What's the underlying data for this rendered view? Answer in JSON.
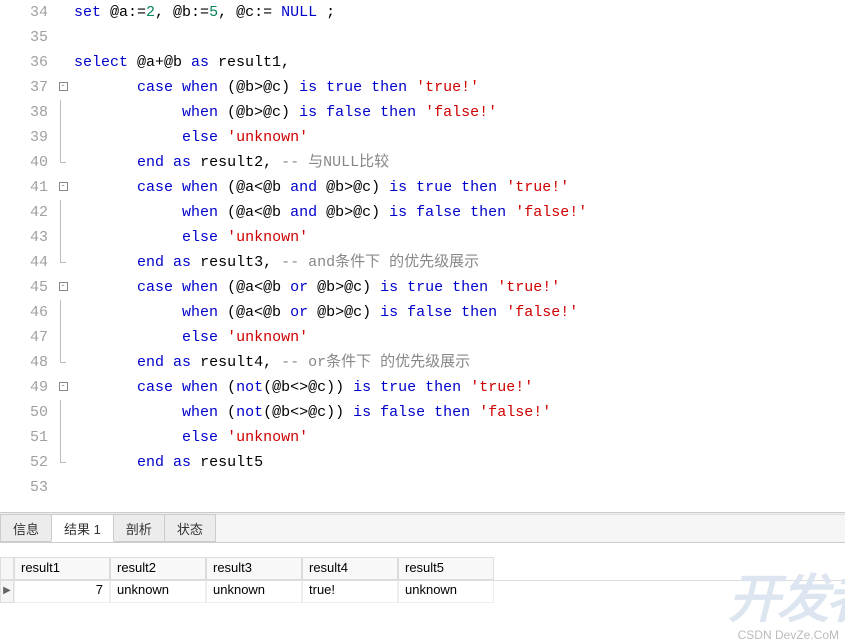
{
  "lines": [
    {
      "n": 34,
      "fold": "",
      "segs": [
        {
          "t": "set",
          "c": "kw"
        },
        {
          "t": " @a:="
        },
        {
          "t": "2",
          "c": "num"
        },
        {
          "t": ", @b:="
        },
        {
          "t": "5",
          "c": "num"
        },
        {
          "t": ", @c:= "
        },
        {
          "t": "NULL",
          "c": "kw"
        },
        {
          "t": " ;"
        }
      ]
    },
    {
      "n": 35,
      "fold": "",
      "segs": [
        {
          "t": ""
        }
      ]
    },
    {
      "n": 36,
      "fold": "",
      "segs": [
        {
          "t": "select",
          "c": "kw"
        },
        {
          "t": " @a+@b "
        },
        {
          "t": "as",
          "c": "kw"
        },
        {
          "t": " result1,"
        }
      ]
    },
    {
      "n": 37,
      "fold": "box",
      "segs": [
        {
          "t": "       "
        },
        {
          "t": "case",
          "c": "kw"
        },
        {
          "t": " "
        },
        {
          "t": "when",
          "c": "kw"
        },
        {
          "t": " (@b>@c) "
        },
        {
          "t": "is",
          "c": "kw"
        },
        {
          "t": " "
        },
        {
          "t": "true",
          "c": "kw"
        },
        {
          "t": " "
        },
        {
          "t": "then",
          "c": "kw"
        },
        {
          "t": " "
        },
        {
          "t": "'true!'",
          "c": "str"
        }
      ]
    },
    {
      "n": 38,
      "fold": "line",
      "segs": [
        {
          "t": "            "
        },
        {
          "t": "when",
          "c": "kw"
        },
        {
          "t": " (@b>@c) "
        },
        {
          "t": "is",
          "c": "kw"
        },
        {
          "t": " "
        },
        {
          "t": "false",
          "c": "kw"
        },
        {
          "t": " "
        },
        {
          "t": "then",
          "c": "kw"
        },
        {
          "t": " "
        },
        {
          "t": "'false!'",
          "c": "str"
        }
      ]
    },
    {
      "n": 39,
      "fold": "line",
      "segs": [
        {
          "t": "            "
        },
        {
          "t": "else",
          "c": "kw"
        },
        {
          "t": " "
        },
        {
          "t": "'unknown'",
          "c": "str"
        }
      ]
    },
    {
      "n": 40,
      "fold": "end",
      "segs": [
        {
          "t": "       "
        },
        {
          "t": "end",
          "c": "kw"
        },
        {
          "t": " "
        },
        {
          "t": "as",
          "c": "kw"
        },
        {
          "t": " result2, "
        },
        {
          "t": "-- 与NULL比较",
          "c": "cmt"
        }
      ]
    },
    {
      "n": 41,
      "fold": "box",
      "segs": [
        {
          "t": "       "
        },
        {
          "t": "case",
          "c": "kw"
        },
        {
          "t": " "
        },
        {
          "t": "when",
          "c": "kw"
        },
        {
          "t": " (@a<@b "
        },
        {
          "t": "and",
          "c": "kw"
        },
        {
          "t": " @b>@c) "
        },
        {
          "t": "is",
          "c": "kw"
        },
        {
          "t": " "
        },
        {
          "t": "true",
          "c": "kw"
        },
        {
          "t": " "
        },
        {
          "t": "then",
          "c": "kw"
        },
        {
          "t": " "
        },
        {
          "t": "'true!'",
          "c": "str"
        }
      ]
    },
    {
      "n": 42,
      "fold": "line",
      "segs": [
        {
          "t": "            "
        },
        {
          "t": "when",
          "c": "kw"
        },
        {
          "t": " (@a<@b "
        },
        {
          "t": "and",
          "c": "kw"
        },
        {
          "t": " @b>@c) "
        },
        {
          "t": "is",
          "c": "kw"
        },
        {
          "t": " "
        },
        {
          "t": "false",
          "c": "kw"
        },
        {
          "t": " "
        },
        {
          "t": "then",
          "c": "kw"
        },
        {
          "t": " "
        },
        {
          "t": "'false!'",
          "c": "str"
        }
      ]
    },
    {
      "n": 43,
      "fold": "line",
      "segs": [
        {
          "t": "            "
        },
        {
          "t": "else",
          "c": "kw"
        },
        {
          "t": " "
        },
        {
          "t": "'unknown'",
          "c": "str"
        }
      ]
    },
    {
      "n": 44,
      "fold": "end",
      "segs": [
        {
          "t": "       "
        },
        {
          "t": "end",
          "c": "kw"
        },
        {
          "t": " "
        },
        {
          "t": "as",
          "c": "kw"
        },
        {
          "t": " result3, "
        },
        {
          "t": "-- and条件下 的优先级展示",
          "c": "cmt"
        }
      ]
    },
    {
      "n": 45,
      "fold": "box",
      "segs": [
        {
          "t": "       "
        },
        {
          "t": "case",
          "c": "kw"
        },
        {
          "t": " "
        },
        {
          "t": "when",
          "c": "kw"
        },
        {
          "t": " (@a<@b "
        },
        {
          "t": "or",
          "c": "kw"
        },
        {
          "t": " @b>@c) "
        },
        {
          "t": "is",
          "c": "kw"
        },
        {
          "t": " "
        },
        {
          "t": "true",
          "c": "kw"
        },
        {
          "t": " "
        },
        {
          "t": "then",
          "c": "kw"
        },
        {
          "t": " "
        },
        {
          "t": "'true!'",
          "c": "str"
        }
      ]
    },
    {
      "n": 46,
      "fold": "line",
      "segs": [
        {
          "t": "            "
        },
        {
          "t": "when",
          "c": "kw"
        },
        {
          "t": " (@a<@b "
        },
        {
          "t": "or",
          "c": "kw"
        },
        {
          "t": " @b>@c) "
        },
        {
          "t": "is",
          "c": "kw"
        },
        {
          "t": " "
        },
        {
          "t": "false",
          "c": "kw"
        },
        {
          "t": " "
        },
        {
          "t": "then",
          "c": "kw"
        },
        {
          "t": " "
        },
        {
          "t": "'false!'",
          "c": "str"
        }
      ]
    },
    {
      "n": 47,
      "fold": "line",
      "segs": [
        {
          "t": "            "
        },
        {
          "t": "else",
          "c": "kw"
        },
        {
          "t": " "
        },
        {
          "t": "'unknown'",
          "c": "str"
        }
      ]
    },
    {
      "n": 48,
      "fold": "end",
      "segs": [
        {
          "t": "       "
        },
        {
          "t": "end",
          "c": "kw"
        },
        {
          "t": " "
        },
        {
          "t": "as",
          "c": "kw"
        },
        {
          "t": " result4, "
        },
        {
          "t": "-- or条件下 的优先级展示",
          "c": "cmt"
        }
      ]
    },
    {
      "n": 49,
      "fold": "box",
      "segs": [
        {
          "t": "       "
        },
        {
          "t": "case",
          "c": "kw"
        },
        {
          "t": " "
        },
        {
          "t": "when",
          "c": "kw"
        },
        {
          "t": " ("
        },
        {
          "t": "not",
          "c": "kw"
        },
        {
          "t": "(@b<>@c)) "
        },
        {
          "t": "is",
          "c": "kw"
        },
        {
          "t": " "
        },
        {
          "t": "true",
          "c": "kw"
        },
        {
          "t": " "
        },
        {
          "t": "then",
          "c": "kw"
        },
        {
          "t": " "
        },
        {
          "t": "'true!'",
          "c": "str"
        }
      ]
    },
    {
      "n": 50,
      "fold": "line",
      "segs": [
        {
          "t": "            "
        },
        {
          "t": "when",
          "c": "kw"
        },
        {
          "t": " ("
        },
        {
          "t": "not",
          "c": "kw"
        },
        {
          "t": "(@b<>@c)) "
        },
        {
          "t": "is",
          "c": "kw"
        },
        {
          "t": " "
        },
        {
          "t": "false",
          "c": "kw"
        },
        {
          "t": " "
        },
        {
          "t": "then",
          "c": "kw"
        },
        {
          "t": " "
        },
        {
          "t": "'false!'",
          "c": "str"
        }
      ]
    },
    {
      "n": 51,
      "fold": "line",
      "segs": [
        {
          "t": "            "
        },
        {
          "t": "else",
          "c": "kw"
        },
        {
          "t": " "
        },
        {
          "t": "'unknown'",
          "c": "str"
        }
      ]
    },
    {
      "n": 52,
      "fold": "end",
      "segs": [
        {
          "t": "       "
        },
        {
          "t": "end",
          "c": "kw"
        },
        {
          "t": " "
        },
        {
          "t": "as",
          "c": "kw"
        },
        {
          "t": " result5"
        }
      ]
    },
    {
      "n": 53,
      "fold": "",
      "segs": [
        {
          "t": ""
        }
      ]
    }
  ],
  "tabs": {
    "info": "信息",
    "results": "结果 1",
    "profile": "剖析",
    "status": "状态"
  },
  "results": {
    "headers": [
      "result1",
      "result2",
      "result3",
      "result4",
      "result5"
    ],
    "row": [
      "7",
      "unknown",
      "unknown",
      "true!",
      "unknown"
    ]
  },
  "watermark1": "开发者",
  "watermark2": "CSDN DevZe.CoM"
}
